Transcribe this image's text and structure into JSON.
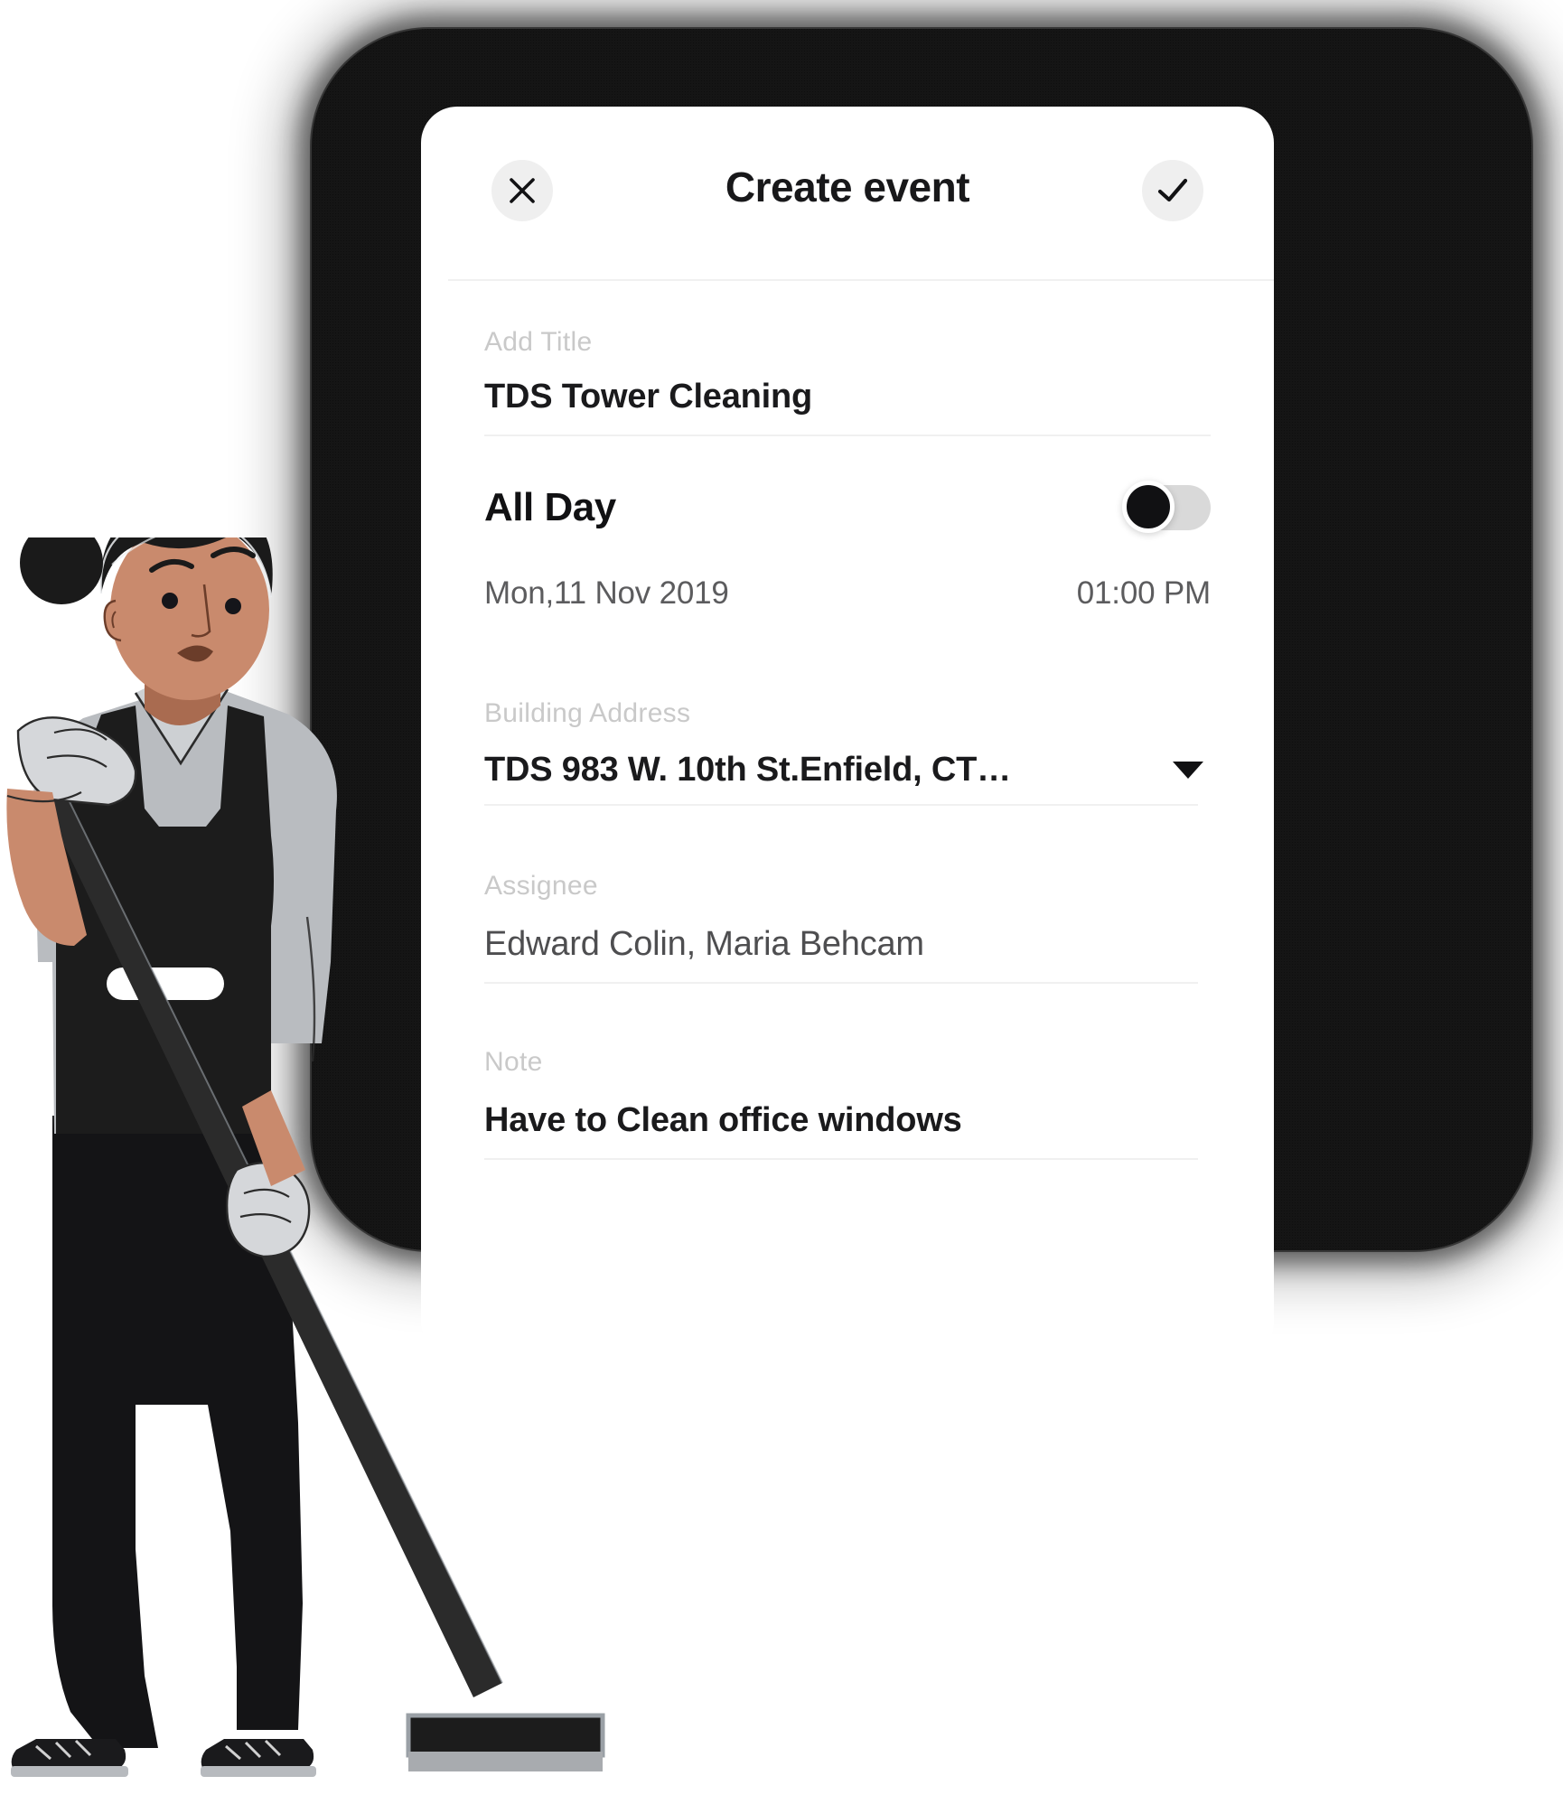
{
  "screen": {
    "background_color": "#ffffff",
    "backdrop_color": "#0b0b0b",
    "card_color": "#ffffff"
  },
  "header": {
    "title": "Create event",
    "close_icon": "close-icon",
    "confirm_icon": "check-icon",
    "button_background": "#efefef"
  },
  "form": {
    "title_field": {
      "label": "Add Title",
      "value": "TDS Tower Cleaning"
    },
    "all_day": {
      "label": "All Day",
      "enabled": false
    },
    "schedule": {
      "date": "Mon,11 Nov 2019",
      "time": "01:00 PM"
    },
    "address_field": {
      "label": "Building Address",
      "value": "TDS 983 W. 10th St.Enfield, CT…",
      "dropdown_icon": "chevron-down-icon"
    },
    "assignee_field": {
      "label": "Assignee",
      "value": "Edward Colin, Maria Behcam"
    },
    "note_field": {
      "label": "Note",
      "value": "Have to Clean office windows"
    }
  },
  "illustration": {
    "name": "cleaner-with-squeegee",
    "skin_color": "#c98a6d",
    "hair_color": "#1a1a1a",
    "shirt_color": "#b9bcc0",
    "overall_color": "#1c1c1c",
    "glove_color": "#d5d7da",
    "tool_color": "#2b2b2b"
  }
}
